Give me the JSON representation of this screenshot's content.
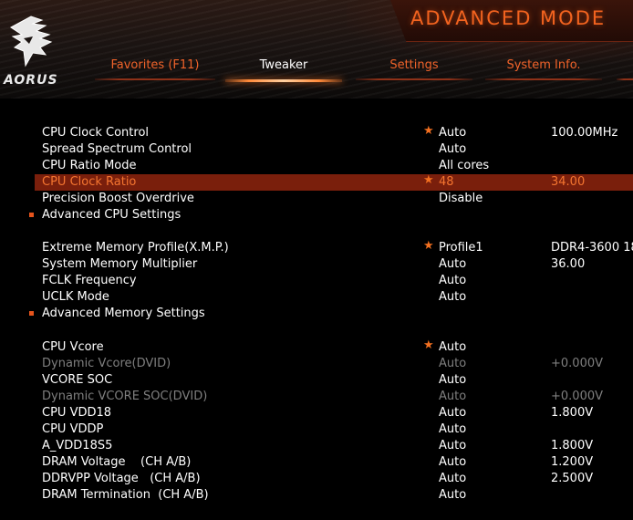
{
  "header": {
    "mode_title": "ADVANCED MODE",
    "brand": "AORUS",
    "tabs": [
      {
        "label": "Favorites (F11)",
        "active": false
      },
      {
        "label": "Tweaker",
        "active": true
      },
      {
        "label": "Settings",
        "active": false
      },
      {
        "label": "System Info.",
        "active": false
      }
    ]
  },
  "colors": {
    "accent": "#f2631f",
    "highlight_row": "#7a1f0c",
    "disabled_text": "#7f7f7f"
  },
  "rows": [
    {
      "label": "CPU Clock Control",
      "value": "Auto",
      "extra": "100.00MHz",
      "star": "★"
    },
    {
      "label": "Spread Spectrum Control",
      "value": "Auto",
      "extra": "",
      "star": ""
    },
    {
      "label": "CPU Ratio Mode",
      "value": "All cores",
      "extra": "",
      "star": ""
    },
    {
      "label": "CPU Clock Ratio",
      "value": "48",
      "extra": "34.00",
      "star": "★"
    },
    {
      "label": "Precision Boost Overdrive",
      "value": "Disable",
      "extra": "",
      "star": ""
    },
    {
      "label": "Advanced CPU Settings",
      "value": "",
      "extra": "",
      "star": ""
    },
    {
      "label": "Extreme Memory Profile(X.M.P.)",
      "value": "Profile1",
      "extra": "DDR4-3600 18",
      "star": "★"
    },
    {
      "label": "System Memory Multiplier",
      "value": "Auto",
      "extra": "36.00",
      "star": ""
    },
    {
      "label": "FCLK Frequency",
      "value": "Auto",
      "extra": "",
      "star": ""
    },
    {
      "label": "UCLK Mode",
      "value": "Auto",
      "extra": "",
      "star": ""
    },
    {
      "label": "Advanced Memory Settings",
      "value": "",
      "extra": "",
      "star": ""
    },
    {
      "label": "CPU Vcore",
      "value": "Auto",
      "extra": "",
      "star": "★"
    },
    {
      "label": "Dynamic Vcore(DVID)",
      "value": "Auto",
      "extra": "+0.000V",
      "star": ""
    },
    {
      "label": "VCORE SOC",
      "value": "Auto",
      "extra": "",
      "star": ""
    },
    {
      "label": "Dynamic VCORE SOC(DVID)",
      "value": "Auto",
      "extra": "+0.000V",
      "star": ""
    },
    {
      "label": "CPU VDD18",
      "value": "Auto",
      "extra": "1.800V",
      "star": ""
    },
    {
      "label": "CPU VDDP",
      "value": "Auto",
      "extra": "",
      "star": ""
    },
    {
      "label": "A_VDD18S5",
      "value": "Auto",
      "extra": "1.800V",
      "star": ""
    },
    {
      "label": "DRAM Voltage    (CH A/B)",
      "value": "Auto",
      "extra": "1.200V",
      "star": ""
    },
    {
      "label": "DDRVPP Voltage   (CH A/B)",
      "value": "Auto",
      "extra": "2.500V",
      "star": ""
    },
    {
      "label": "DRAM Termination  (CH A/B)",
      "value": "Auto",
      "extra": "",
      "star": ""
    }
  ]
}
